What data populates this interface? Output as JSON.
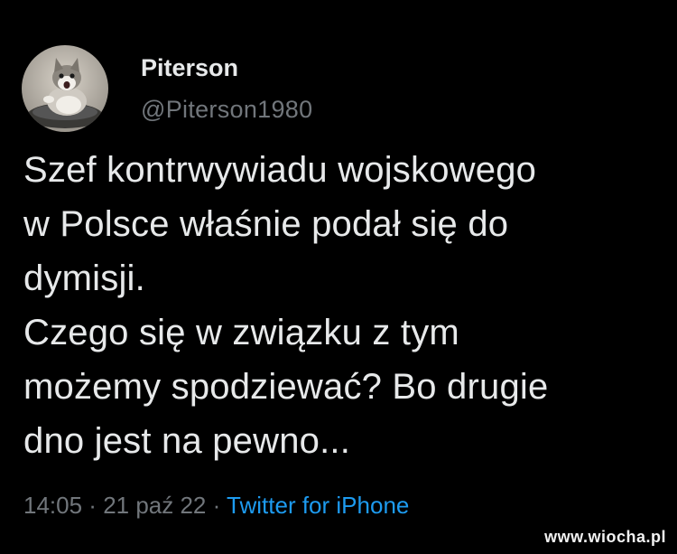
{
  "tweet": {
    "display_name": "Piterson",
    "handle": "@Piterson1980",
    "text": "Szef kontrwywiadu wojskowego\nw Polsce właśnie podał się do\ndymisji.\nCzego się w związku z tym\nmożemy spodziewać? Bo drugie\ndno jest na pewno...",
    "time": "14:05",
    "date": "21 paź 22",
    "source": "Twitter for iPhone",
    "separator": " · "
  },
  "avatar": {
    "icon": "cat-avatar-icon"
  },
  "watermark": {
    "text": "www.wiocha.pl"
  },
  "colors": {
    "background": "#000000",
    "text": "#e7e9ea",
    "secondary": "#71767b",
    "accent": "#1d9bf0"
  }
}
